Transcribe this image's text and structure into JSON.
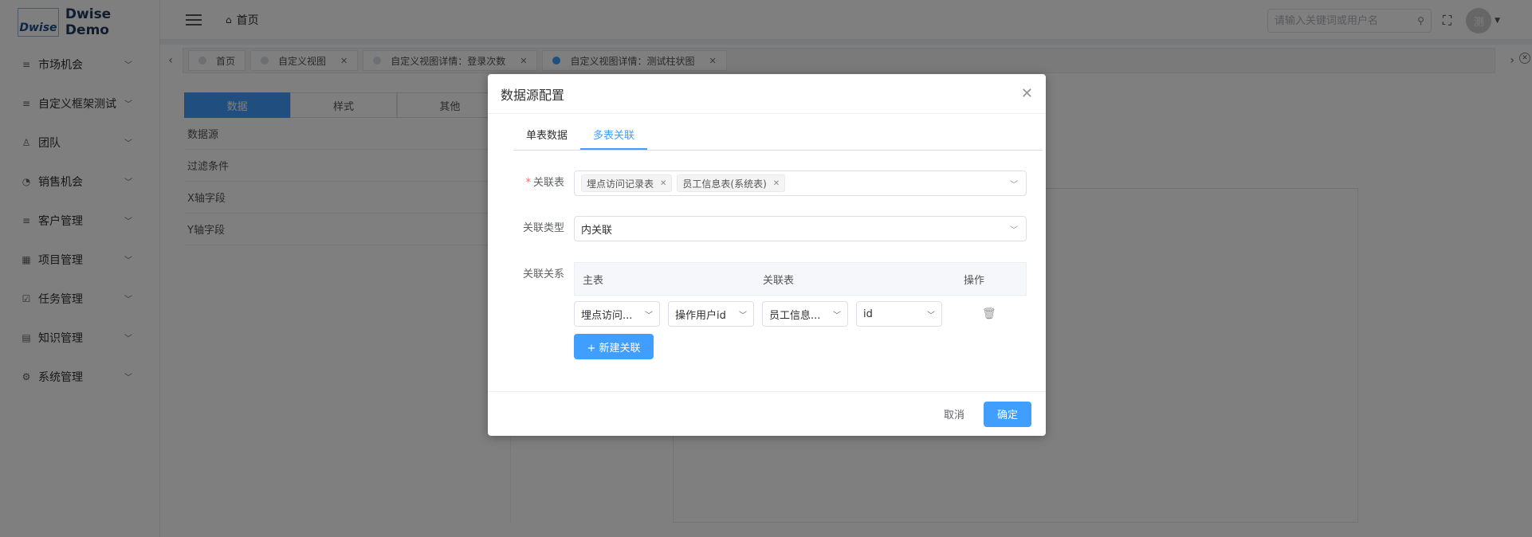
{
  "app": {
    "logo_mark": "Dwise",
    "title": "Dwise Demo"
  },
  "sidebar": {
    "items": [
      {
        "label": "市场机会",
        "icon": "list-icon"
      },
      {
        "label": "自定义框架测试",
        "icon": "list-icon"
      },
      {
        "label": "团队",
        "icon": "user-icon"
      },
      {
        "label": "销售机会",
        "icon": "chart-icon"
      },
      {
        "label": "客户管理",
        "icon": "list-icon"
      },
      {
        "label": "项目管理",
        "icon": "grid-icon"
      },
      {
        "label": "任务管理",
        "icon": "checkbox-icon"
      },
      {
        "label": "知识管理",
        "icon": "book-icon"
      },
      {
        "label": "系统管理",
        "icon": "gear-icon"
      }
    ]
  },
  "header": {
    "breadcrumb": "首页",
    "search_placeholder": "请输入关键词或用户名",
    "avatar_text": "测"
  },
  "tabs": [
    {
      "label": "首页",
      "closable": false,
      "active": false
    },
    {
      "label": "自定义视图",
      "closable": true,
      "active": false
    },
    {
      "label": "自定义视图详情：登录次数",
      "closable": true,
      "active": false
    },
    {
      "label": "自定义视图详情：测试柱状图",
      "closable": true,
      "active": true
    }
  ],
  "background_panel": {
    "segments": [
      "数据",
      "样式",
      "其他"
    ],
    "active_segment": "数据",
    "fields": [
      "数据源",
      "过滤条件",
      "X轴字段",
      "Y轴字段"
    ]
  },
  "dialog": {
    "title": "数据源配置",
    "tabs": [
      "单表数据",
      "多表关联"
    ],
    "active_tab": "多表关联",
    "join_tables_label": "关联表",
    "join_tables": [
      "埋点访问记录表",
      "员工信息表(系统表)"
    ],
    "join_type_label": "关联类型",
    "join_type_value": "内关联",
    "relation_label": "关联关系",
    "relation_columns": [
      "主表",
      "关联表",
      "操作"
    ],
    "relation_rows": [
      {
        "main_table": "埋点访问...",
        "main_field": "操作用户id",
        "join_table": "员工信息...",
        "join_field": "id"
      }
    ],
    "add_relation_label": "+ 新建关联",
    "cancel_label": "取消",
    "confirm_label": "确定"
  },
  "colors": {
    "primary": "#409eff",
    "required": "#f56c6c",
    "overlay": "rgba(0,0,0,0.5)"
  }
}
